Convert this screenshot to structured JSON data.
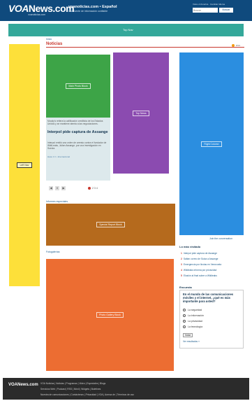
{
  "header": {
    "logo_prefix": "VOA",
    "logo_suffix": "News.com",
    "logo_sub": "voanoticias.com",
    "site_title": "voanoticias.com • Español",
    "tagline": "Una fuente de información confiable",
    "top_links": "Voice of America · Cambiar idioma",
    "search_placeholder": "Buscar",
    "search_button": "Buscar"
  },
  "nav": {
    "label": "Top Nav"
  },
  "breadcrumb": "Inicio",
  "section_title": "Noticias",
  "rss_label": "RSS",
  "ads": {
    "left": "Left Nav",
    "main_photo": "Main Photo Block",
    "top_news": "Top News",
    "right": "Right Column",
    "special_block": "Special Report Block",
    "photo_block": "Photo Gallery Block"
  },
  "story": {
    "summary": "Moody's reitera la calificación crediticia de los Estados Unidos y se mantiene atenta a las negociaciones.",
    "title": "Interpol pide captura de Assange",
    "body": "Interpol emitió una orden de arresto contra el fundador de WikiLeaks, Julian Assange, por una investigación en Suecia.",
    "time": "Hace 1 h • Internacional"
  },
  "pager": {
    "prev": "◀",
    "pause": "II",
    "next": "▶",
    "pages": "2  3  4"
  },
  "special_heading": "Informes especiales",
  "photos_heading": "Fotogalerías",
  "join_link": "Join the conversation",
  "most_read": {
    "heading": "Lo más visitado",
    "items": [
      "Interpol pide captura de Assange",
      "Saltan correo de Suiza a Assange",
      "Emergencia por lluvias en Venezuela",
      "Wikileaks informa por privacidad",
      "Elusión al final sobre a Wikileaks"
    ]
  },
  "poll": {
    "heading": "Encuesta",
    "question": "En el mundo de las comunicaciones móviles y el internet, ¿qué es más importante para usted?",
    "options": [
      "La seguridad",
      "La información",
      "La privacidad",
      "La tecnología"
    ],
    "vote": "Votar",
    "results": "Ver resultados »"
  },
  "footer": {
    "logo": "VOANews.com",
    "lines": [
      "VOA Noticias | Noticias | Programas | Video | Especiales | Blogs",
      "Servicios Web | Podcast | RSS | Móvil | Widgets | Boletines",
      "Nuestra de comunicaciones | Contáctenos | Privacidad | VOA | Acerca de | Términos de uso"
    ]
  },
  "colors": {
    "header_bg": "#0f4a7d",
    "nav_bg": "#34a89a",
    "accent_red": "#c8372d",
    "left_ad": "#fde03a",
    "green_ad": "#3da447",
    "purple_ad": "#8b4bb0",
    "blue_ad": "#2b8ee0",
    "brown_ad": "#b56a1d",
    "orange_ad": "#ec6d32",
    "footer_bg": "#2b2b2b"
  }
}
